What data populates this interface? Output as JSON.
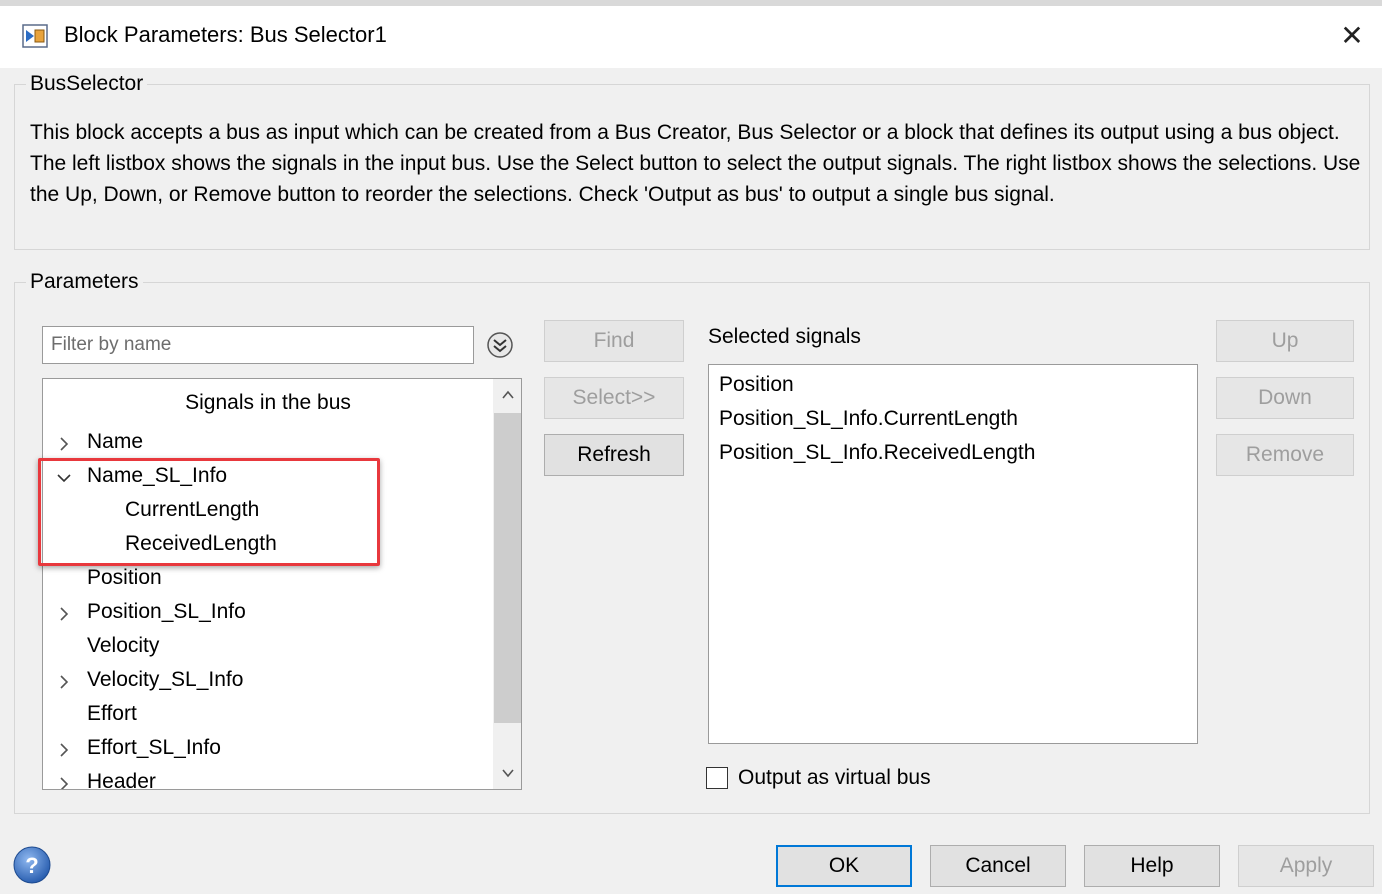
{
  "window": {
    "title": "Block Parameters: Bus Selector1",
    "close_glyph": "✕"
  },
  "bus_selector": {
    "legend": "BusSelector",
    "description": "This block accepts a bus as input which can be created from a Bus Creator, Bus Selector or a block that defines its output using a bus object. The left listbox shows the signals in the input bus. Use the Select button to select the output signals. The right listbox shows the selections. Use the Up, Down, or Remove button to reorder the selections. Check 'Output as bus' to output a single bus signal."
  },
  "parameters": {
    "legend": "Parameters",
    "filter": {
      "placeholder": "Filter by name",
      "value": ""
    },
    "tree_header": "Signals in the bus",
    "signals": [
      {
        "label": "Name",
        "expandable": true,
        "expanded": false
      },
      {
        "label": "Name_SL_Info",
        "expandable": true,
        "expanded": true
      },
      {
        "label": "CurrentLength",
        "child": true
      },
      {
        "label": "ReceivedLength",
        "child": true
      },
      {
        "label": "Position",
        "expandable": false
      },
      {
        "label": "Position_SL_Info",
        "expandable": true,
        "expanded": false
      },
      {
        "label": "Velocity",
        "expandable": false
      },
      {
        "label": "Velocity_SL_Info",
        "expandable": true,
        "expanded": false
      },
      {
        "label": "Effort",
        "expandable": false
      },
      {
        "label": "Effort_SL_Info",
        "expandable": true,
        "expanded": false
      },
      {
        "label": "Header",
        "expandable": true,
        "expanded": false
      }
    ],
    "find_label": "Find",
    "select_label": "Select>>",
    "refresh_label": "Refresh",
    "selected_label": "Selected signals",
    "selected_signals": [
      "Position",
      "Position_SL_Info.CurrentLength",
      "Position_SL_Info.ReceivedLength"
    ],
    "up_label": "Up",
    "down_label": "Down",
    "remove_label": "Remove",
    "virtual_bus_label": "Output as virtual bus",
    "virtual_bus_checked": false
  },
  "footer": {
    "ok": "OK",
    "cancel": "Cancel",
    "help": "Help",
    "apply": "Apply"
  },
  "colors": {
    "highlight": "#e8383d",
    "default_button_border": "#0078d7",
    "disabled_text": "#9e9e9e"
  }
}
